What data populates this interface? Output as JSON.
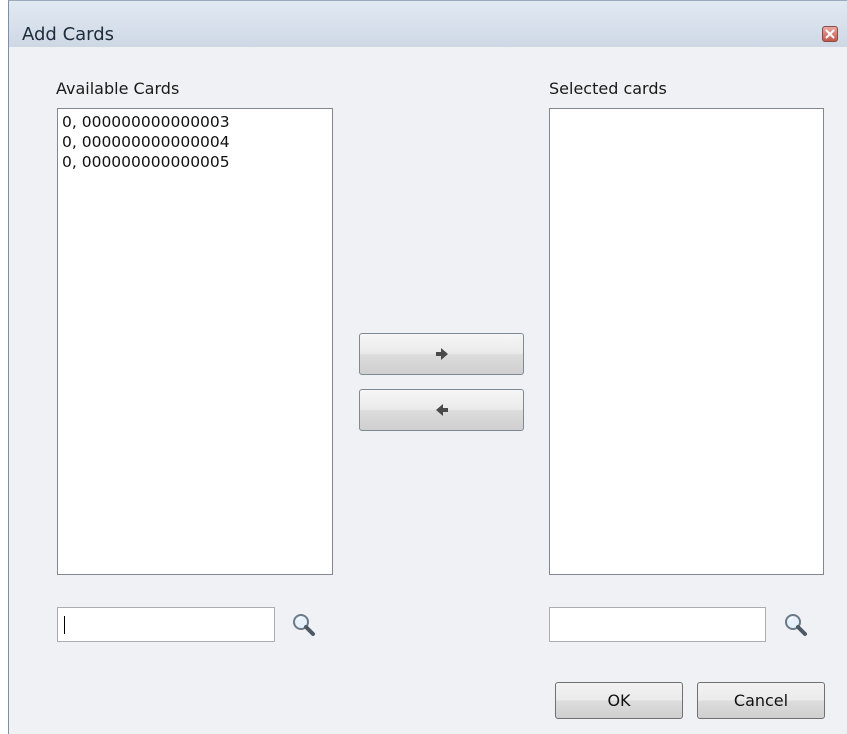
{
  "window": {
    "title": "Add Cards"
  },
  "available": {
    "label": "Available Cards",
    "items": [
      "0, 000000000000003",
      "0, 000000000000004",
      "0, 000000000000005"
    ],
    "search_value": ""
  },
  "selected": {
    "label": "Selected cards",
    "items": [],
    "search_value": ""
  },
  "actions": {
    "move_right_icon": "arrow-right-icon",
    "move_left_icon": "arrow-left-icon"
  },
  "buttons": {
    "ok_label": "OK",
    "cancel_label": "Cancel"
  }
}
